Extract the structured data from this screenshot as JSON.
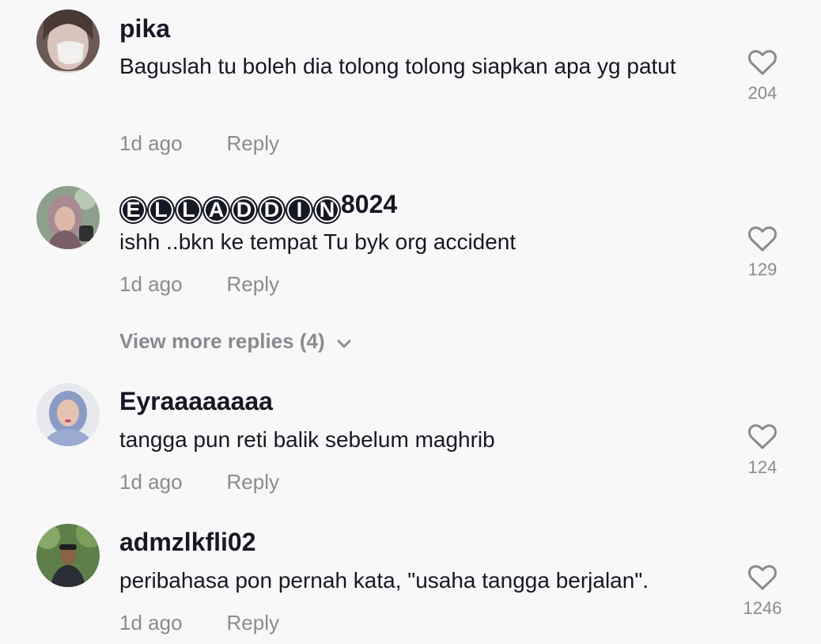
{
  "comments": [
    {
      "username": "pika",
      "text": "Baguslah tu boleh dia tolong tolong siapkan apa yg patut",
      "time": "1d ago",
      "reply_label": "Reply",
      "likes": "204"
    },
    {
      "username_circled": [
        "E",
        "L",
        "L",
        "A",
        "D",
        "D",
        "I",
        "N"
      ],
      "username_suffix": "8024",
      "text": "ishh ..bkn ke tempat Tu byk org accident",
      "time": "1d ago",
      "reply_label": "Reply",
      "likes": "129"
    },
    {
      "username": "Eyraaaaaaaa",
      "text": "tangga pun reti balik sebelum maghrib",
      "time": "1d ago",
      "reply_label": "Reply",
      "likes": "124"
    },
    {
      "username": "admzlkfli02",
      "text": "peribahasa pon pernah kata, \"usaha tangga berjalan\".",
      "time": "1d ago",
      "reply_label": "Reply",
      "likes": "1246"
    }
  ],
  "view_more_replies": "View more replies (4)",
  "icons": {
    "like": "heart-outline-icon",
    "expand": "chevron-down-icon"
  },
  "colors": {
    "background": "#f8f8f8",
    "primary_text": "#161823",
    "secondary_text": "#8a8b91"
  }
}
